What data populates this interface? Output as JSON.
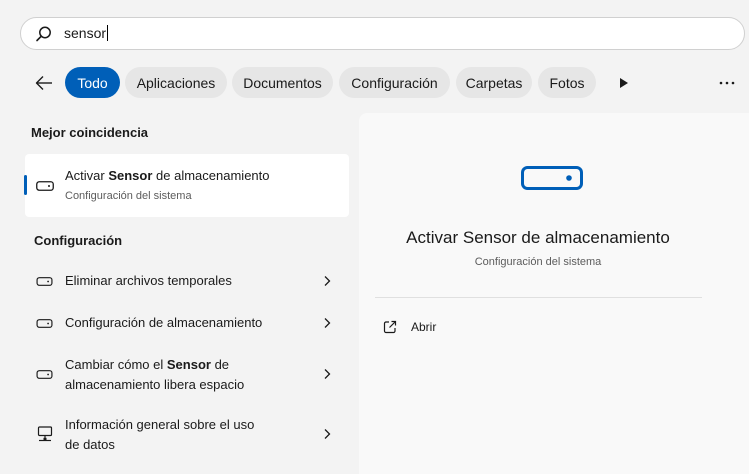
{
  "search": {
    "query": "sensor"
  },
  "filters": {
    "back_icon": "arrow-left-icon",
    "chips": [
      "Todo",
      "Aplicaciones",
      "Documentos",
      "Configuración",
      "Carpetas",
      "Fotos"
    ],
    "active_index": 0,
    "more_icon": "play-icon",
    "overflow_icon": "more-horizontal-icon"
  },
  "best_match": {
    "heading": "Mejor coincidencia",
    "title_pre": "Activar ",
    "title_bold": "Sensor",
    "title_post": " de almacenamiento",
    "subtitle": "Configuración del sistema",
    "icon": "drive-icon"
  },
  "settings_section": {
    "heading": "Configuración",
    "items": [
      {
        "pre": "Eliminar archivos temporales",
        "icon": "drive-icon"
      },
      {
        "pre": "Configuración de almacenamiento",
        "icon": "drive-icon"
      },
      {
        "line1_pre": "Cambiar cómo el ",
        "line1_bold": "Sensor",
        "line1_post": " de",
        "line2": "almacenamiento libera espacio",
        "icon": "drive-icon"
      },
      {
        "line1": "Información general sobre el uso",
        "line2": "de datos",
        "icon": "network-pc-icon"
      }
    ]
  },
  "details": {
    "title": "Activar Sensor de almacenamiento",
    "subtitle": "Configuración del sistema",
    "action_label": "Abrir",
    "action_icon": "open-external-icon",
    "accent_color": "#005fb8"
  }
}
